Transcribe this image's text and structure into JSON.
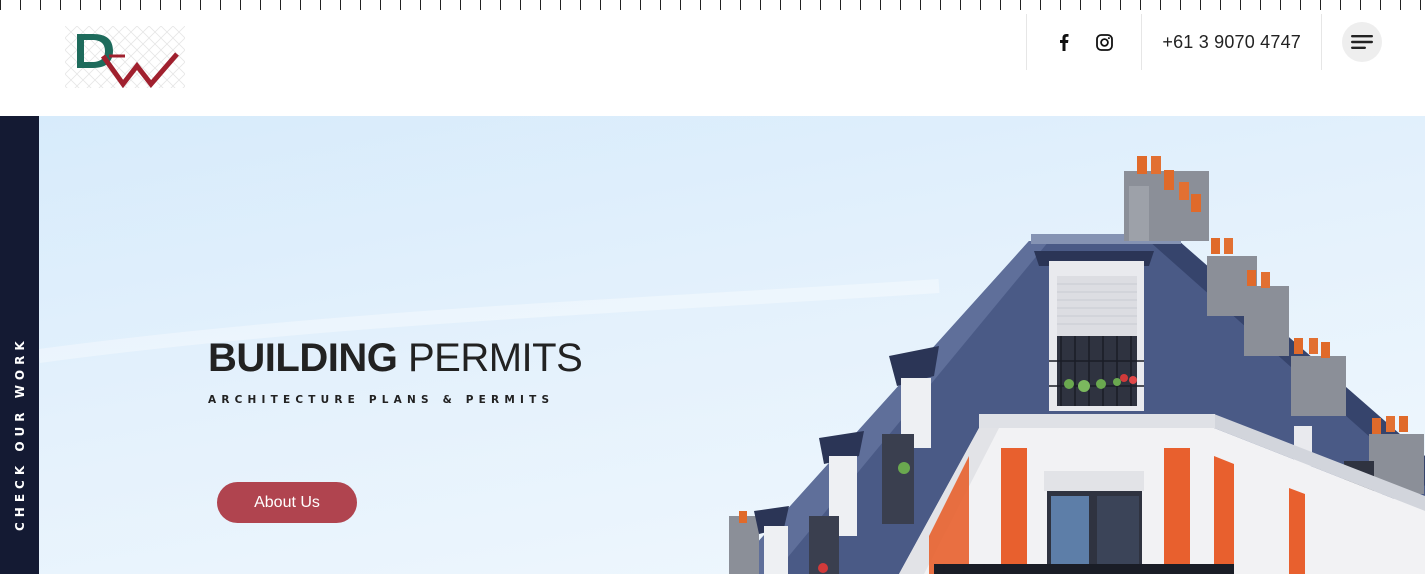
{
  "header": {
    "logo_alt": "DW",
    "social": [
      {
        "name": "facebook-icon"
      },
      {
        "name": "instagram-icon"
      }
    ],
    "phone": "+61 3 9070 4747",
    "menu_icon": "hamburger-menu-icon"
  },
  "sidebar": {
    "label": "CHECK OUR WORK"
  },
  "hero": {
    "title_bold": "BUILDING",
    "title_light": "PERMITS",
    "subtitle": "ARCHITECTURE PLANS & PERMITS",
    "button_label": "About Us"
  },
  "colors": {
    "accent": "#b0444f",
    "sidebar": "#141a33",
    "logo_green": "#1e6b5c",
    "logo_red": "#a0202e"
  }
}
